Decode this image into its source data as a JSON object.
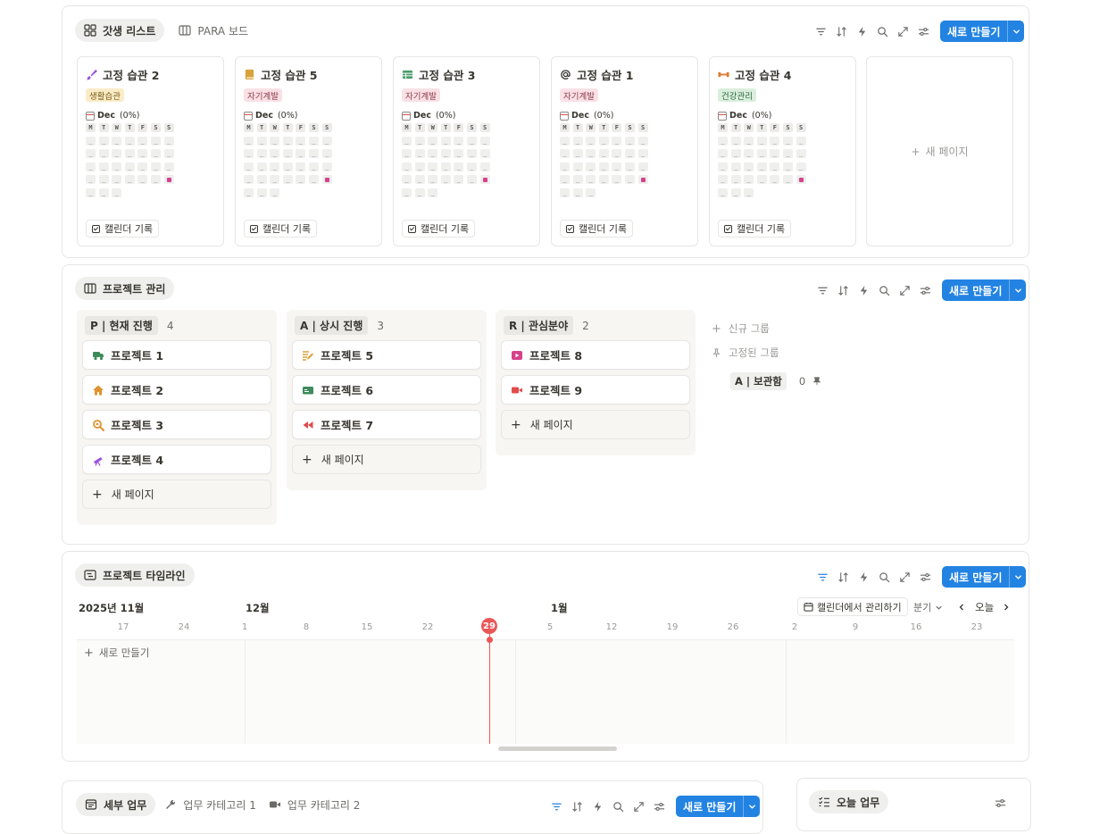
{
  "habits": {
    "tabs": [
      {
        "label": "갓생 리스트",
        "icon": "gallery-icon",
        "active": true
      },
      {
        "label": "PARA 보드",
        "icon": "board-icon",
        "active": false
      }
    ],
    "new_label": "새로 만들기",
    "cards": [
      {
        "title": "고정 습관 2",
        "icon": "brush-icon",
        "icon_color": "#9b51e0",
        "tag": "생활습관",
        "tag_bg": "#fbecc8",
        "tag_color": "#7a5b14",
        "month": "Dec",
        "percent": "(0%)",
        "button": "캘린더 기록"
      },
      {
        "title": "고정 습관 5",
        "icon": "book-icon",
        "icon_color": "#d9a23b",
        "tag": "자기계발",
        "tag_bg": "#f9e1e5",
        "tag_color": "#8d3a4c",
        "month": "Dec",
        "percent": "(0%)",
        "button": "캘린더 기록"
      },
      {
        "title": "고정 습관 3",
        "icon": "table-icon",
        "icon_color": "#4a9b6b",
        "tag": "자기계발",
        "tag_bg": "#f9e1e5",
        "tag_color": "#8d3a4c",
        "month": "Dec",
        "percent": "(0%)",
        "button": "캘린더 기록"
      },
      {
        "title": "고정 습관 1",
        "icon": "at-icon",
        "icon_color": "#37352f",
        "tag": "자기계발",
        "tag_bg": "#f9e1e5",
        "tag_color": "#8d3a4c",
        "month": "Dec",
        "percent": "(0%)",
        "button": "캘린더 기록"
      },
      {
        "title": "고정 습관 4",
        "icon": "dumbbell-icon",
        "icon_color": "#e07b30",
        "tag": "건강관리",
        "tag_bg": "#dbeedd",
        "tag_color": "#2e6b3d",
        "month": "Dec",
        "percent": "(0%)",
        "button": "캘린더 기록"
      }
    ],
    "weekdays": [
      "M",
      "T",
      "W",
      "T",
      "F",
      "S",
      "S"
    ],
    "grid_placeholder": "_",
    "new_page": "새 페이지"
  },
  "projects": {
    "tab": "프로젝트 관리",
    "new_label": "새로 만들기",
    "columns": [
      {
        "tag": "P | 현재 진행",
        "count": "4",
        "items": [
          {
            "name": "프로젝트 1",
            "icon": "truck-icon",
            "icon_color": "#3d8b5a"
          },
          {
            "name": "프로젝트 2",
            "icon": "home-icon",
            "icon_color": "#e0922f"
          },
          {
            "name": "프로젝트 3",
            "icon": "magnifier-icon",
            "icon_color": "#e0922f"
          },
          {
            "name": "프로젝트 4",
            "icon": "telescope-icon",
            "icon_color": "#9b51e0"
          }
        ]
      },
      {
        "tag": "A | 상시 진행",
        "count": "3",
        "items": [
          {
            "name": "프로젝트 5",
            "icon": "notes-icon",
            "icon_color": "#d9a23b"
          },
          {
            "name": "프로젝트 6",
            "icon": "id-card-icon",
            "icon_color": "#3d8b5a"
          },
          {
            "name": "프로젝트 7",
            "icon": "rewind-icon",
            "icon_color": "#e04b4b"
          }
        ]
      },
      {
        "tag": "R | 관심분야",
        "count": "2",
        "items": [
          {
            "name": "프로젝트 8",
            "icon": "video-play-icon",
            "icon_color": "#d6418a"
          },
          {
            "name": "프로젝트 9",
            "icon": "video-camera-icon",
            "icon_color": "#e04b4b"
          }
        ]
      }
    ],
    "new_page": "새 페이지",
    "new_group": "신규 그룹",
    "pinned_group": "고정된 그룹",
    "archive_tag": "A | 보관함",
    "archive_count": "0"
  },
  "timeline": {
    "tab": "프로젝트 타임라인",
    "new_label": "새로 만들기",
    "months": [
      {
        "label": "2025년 11월"
      },
      {
        "label": "12월"
      },
      {
        "label": "1월"
      }
    ],
    "days": [
      "17",
      "24",
      "1",
      "8",
      "15",
      "22",
      "29",
      "5",
      "12",
      "19",
      "26",
      "2",
      "9",
      "16",
      "23"
    ],
    "today": "29",
    "manage_label": "캘린더에서 관리하기",
    "range_label": "분기",
    "today_label": "오늘",
    "new_row": "새로 만들기"
  },
  "tasks": {
    "tabs": [
      {
        "label": "세부 업무",
        "icon": "calendar-icon",
        "active": true
      },
      {
        "label": "업무 카테고리 1",
        "icon": "wrench-icon",
        "active": false
      },
      {
        "label": "업무 카테고리 2",
        "icon": "video-camera-icon",
        "active": false
      }
    ],
    "new_label": "새로 만들기"
  },
  "today_tasks": {
    "tab": "오늘 업무"
  },
  "colors": {
    "accent": "#2383e2",
    "today": "#eb5757"
  }
}
